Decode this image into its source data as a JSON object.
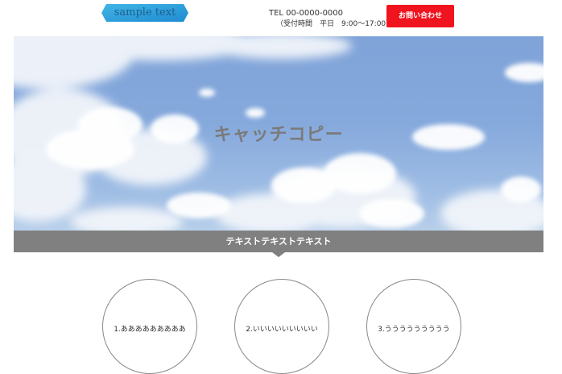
{
  "header": {
    "logo_text": "sample text",
    "tel": "TEL 00-0000-0000",
    "hours": "（受付時間　平日　9:00〜17:00）",
    "contact_button": "お問い合わせ"
  },
  "hero": {
    "catch_copy": "キャッチコピー"
  },
  "banner": {
    "text": "テキストテキストテキスト"
  },
  "features": [
    {
      "label": "1.あああああああああ"
    },
    {
      "label": "2.いいいいいいいいい"
    },
    {
      "label": "3.ううううううううう"
    }
  ],
  "colors": {
    "contact_button": "#f0141e",
    "banner": "#808080",
    "logo_gradient": [
      "#3ab0e2",
      "#1f8fd0"
    ]
  }
}
